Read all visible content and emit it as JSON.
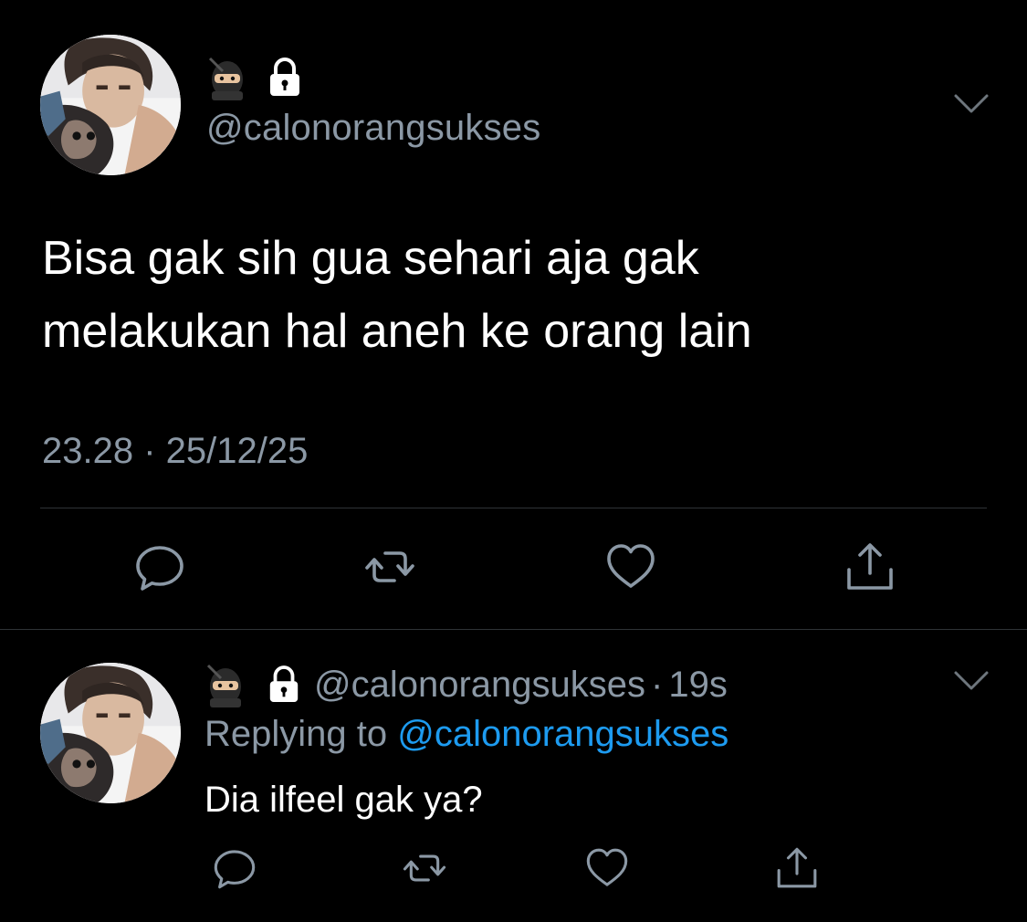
{
  "colors": {
    "background": "#000000",
    "text_primary": "#ffffff",
    "text_secondary": "#8b98a5",
    "link": "#1d9bf0",
    "divider": "#2f3336"
  },
  "main_tweet": {
    "display_name_icons": [
      "ninja-emoji",
      "lock-icon"
    ],
    "handle": "@calonorangsukses",
    "text": "Bisa gak sih gua sehari aja gak\nmelakukan hal aneh ke orang lain",
    "timestamp": "23.28 · 25/12/25",
    "actions": [
      "reply-icon",
      "retweet-icon",
      "like-icon",
      "share-icon"
    ]
  },
  "reply_tweet": {
    "display_name_icons": [
      "ninja-emoji",
      "lock-icon"
    ],
    "handle": "@calonorangsukses",
    "separator": "·",
    "time": "19s",
    "replying_prefix": "Replying to ",
    "replying_to": "@calonorangsukses",
    "text": "Dia ilfeel gak ya?",
    "actions": [
      "reply-icon",
      "retweet-icon",
      "like-icon",
      "share-icon"
    ]
  }
}
